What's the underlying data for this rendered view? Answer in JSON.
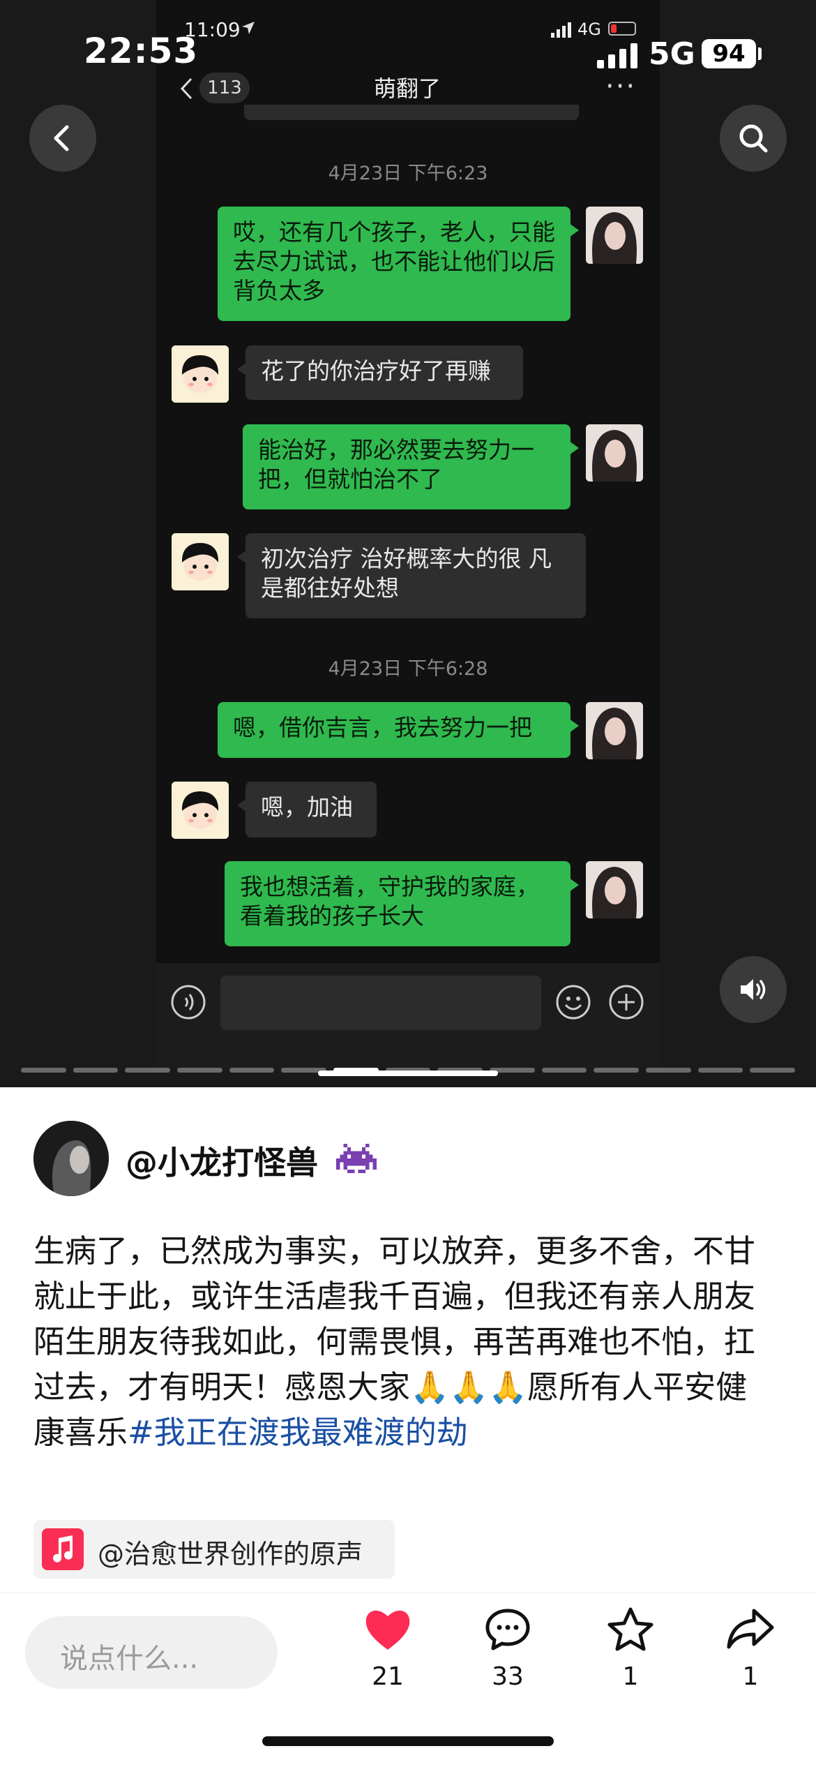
{
  "os_status": {
    "time": "22:53",
    "network": "5G",
    "battery": "94"
  },
  "screenshot": {
    "status": {
      "time": "11:09",
      "network": "4G"
    },
    "header": {
      "unread_count": "113",
      "title": "萌翻了",
      "more": "···"
    },
    "messages": [
      {
        "type": "timestamp",
        "text": "4月23日 下午6:23"
      },
      {
        "type": "me",
        "text": "哎，还有几个孩子，老人，只能去尽力试试，也不能让他们以后背负太多"
      },
      {
        "type": "them",
        "text": "花了的你治疗好了再赚"
      },
      {
        "type": "me",
        "text": "能治好，那必然要去努力一把，但就怕治不了"
      },
      {
        "type": "them",
        "text": "初次治疗 治好概率大的很 凡是都往好处想"
      },
      {
        "type": "timestamp",
        "text": "4月23日 下午6:28"
      },
      {
        "type": "me",
        "text": "嗯，借你吉言，我去努力一把"
      },
      {
        "type": "them",
        "text": "嗯，加油"
      },
      {
        "type": "me",
        "text": "我也想活着，守护我的家庭，看着我的孩子长大"
      }
    ]
  },
  "post": {
    "author": "@小龙打怪兽",
    "author_icon": "alien-monster-icon",
    "caption": "生病了，已然成为事实，可以放弃，更多不舍，不甘就止于此，或许生活虐我千百遍，但我还有亲人朋友陌生朋友待我如此，何需畏惧，再苦再难也不怕，扛过去，才有明天！感恩大家🙏🙏🙏愿所有人平安健康喜乐",
    "hashtag": "#我正在渡我最难渡的劫",
    "music": "@治愈世界创作的原声"
  },
  "bottom_bar": {
    "comment_placeholder": "说点什么...",
    "like_count": "21",
    "comment_count": "33",
    "favorite_count": "1",
    "share_count": "1"
  },
  "colors": {
    "accent_like": "#fe2c55",
    "bubble_me": "#2fb94f",
    "hashtag": "#1a4fa3"
  },
  "progress": {
    "segments": 15,
    "current": 6
  }
}
